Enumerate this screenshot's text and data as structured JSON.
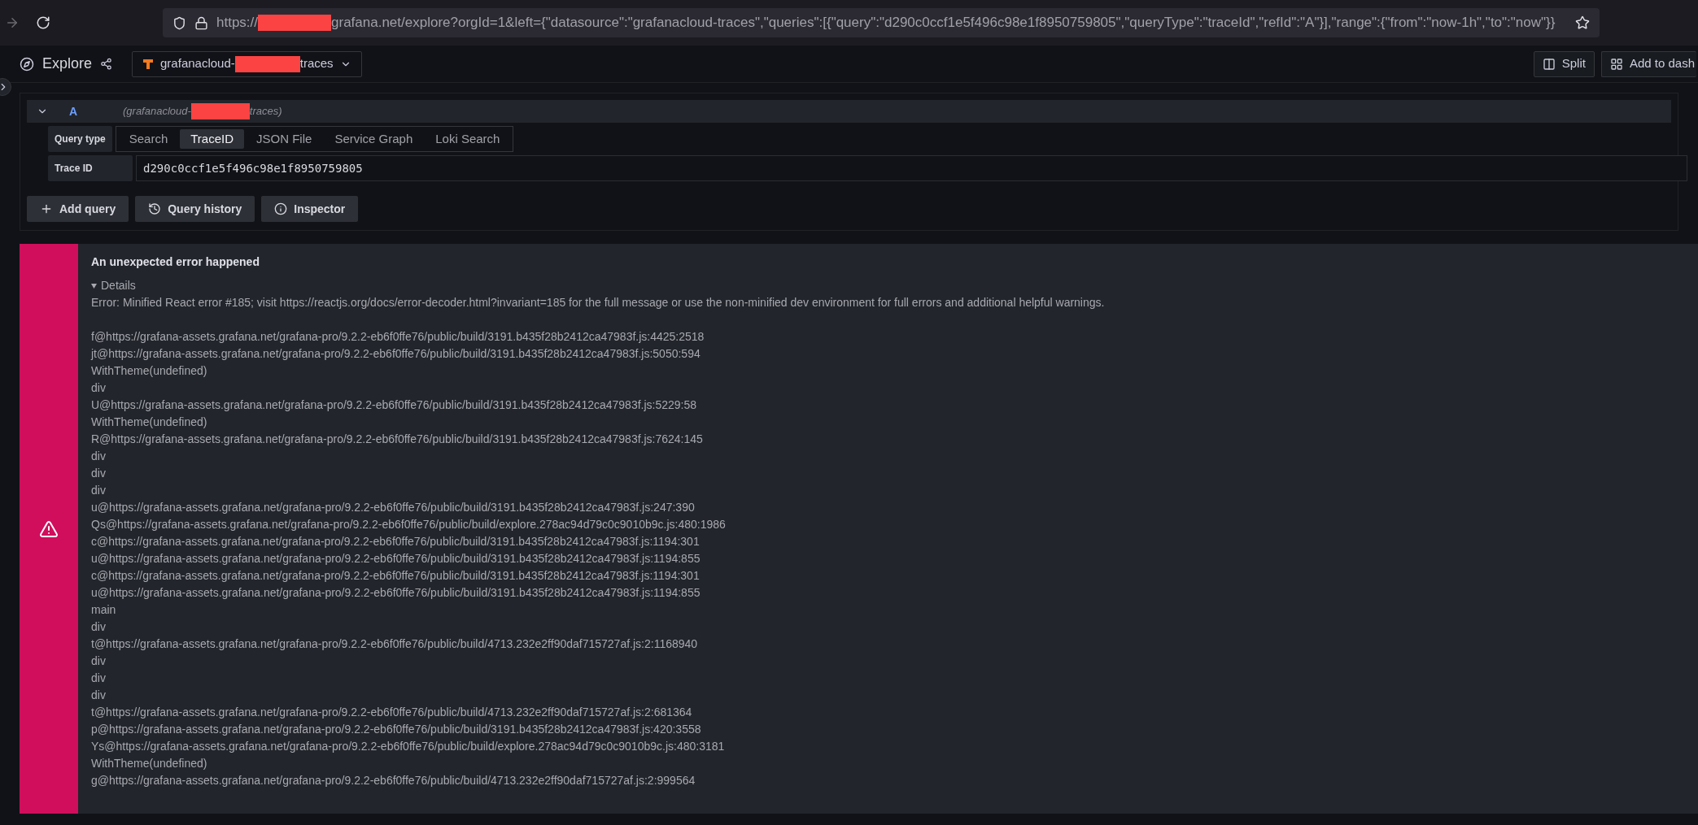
{
  "browser": {
    "url_prefix": "https://",
    "url_rest": "grafana.net/explore?orgId=1&left={\"datasource\":\"grafanacloud-traces\",\"queries\":[{\"query\":\"d290c0ccf1e5f496c98e1f8950759805\",\"queryType\":\"traceId\",\"refId\":\"A\"}],\"range\":{\"from\":\"now-1h\",\"to\":\"now\"}}"
  },
  "header": {
    "title": "Explore",
    "datasource_prefix": "grafanacloud-",
    "datasource_suffix": "traces",
    "buttons": [
      "Split",
      "Add to dash"
    ]
  },
  "query": {
    "ref": "A",
    "source_prefix": "(grafanacloud-",
    "source_suffix": "traces)",
    "type_label": "Query type",
    "types": [
      {
        "label": "Search",
        "selected": false
      },
      {
        "label": "TraceID",
        "selected": true
      },
      {
        "label": "JSON File",
        "selected": false
      },
      {
        "label": "Service Graph",
        "selected": false
      },
      {
        "label": "Loki Search",
        "selected": false
      }
    ],
    "trace_label": "Trace ID",
    "trace_value": "d290c0ccf1e5f496c98e1f8950759805"
  },
  "actions": [
    {
      "kind": "add",
      "label": "Add query"
    },
    {
      "kind": "history",
      "label": "Query history"
    },
    {
      "kind": "inspect",
      "label": "Inspector"
    }
  ],
  "error": {
    "title": "An unexpected error happened",
    "details_label": "Details",
    "message": "Error: Minified React error #185; visit https://reactjs.org/docs/error-decoder.html?invariant=185 for the full message or use the non-minified dev environment for full errors and additional helpful warnings.",
    "stack": [
      "f@https://grafana-assets.grafana.net/grafana-pro/9.2.2-eb6f0ffe76/public/build/3191.b435f28b2412ca47983f.js:4425:2518",
      "jt@https://grafana-assets.grafana.net/grafana-pro/9.2.2-eb6f0ffe76/public/build/3191.b435f28b2412ca47983f.js:5050:594",
      "WithTheme(undefined)",
      "div",
      "U@https://grafana-assets.grafana.net/grafana-pro/9.2.2-eb6f0ffe76/public/build/3191.b435f28b2412ca47983f.js:5229:58",
      "WithTheme(undefined)",
      "R@https://grafana-assets.grafana.net/grafana-pro/9.2.2-eb6f0ffe76/public/build/3191.b435f28b2412ca47983f.js:7624:145",
      "div",
      "div",
      "div",
      "u@https://grafana-assets.grafana.net/grafana-pro/9.2.2-eb6f0ffe76/public/build/3191.b435f28b2412ca47983f.js:247:390",
      "Qs@https://grafana-assets.grafana.net/grafana-pro/9.2.2-eb6f0ffe76/public/build/explore.278ac94d79c0c9010b9c.js:480:1986",
      "c@https://grafana-assets.grafana.net/grafana-pro/9.2.2-eb6f0ffe76/public/build/3191.b435f28b2412ca47983f.js:1194:301",
      "u@https://grafana-assets.grafana.net/grafana-pro/9.2.2-eb6f0ffe76/public/build/3191.b435f28b2412ca47983f.js:1194:855",
      "c@https://grafana-assets.grafana.net/grafana-pro/9.2.2-eb6f0ffe76/public/build/3191.b435f28b2412ca47983f.js:1194:301",
      "u@https://grafana-assets.grafana.net/grafana-pro/9.2.2-eb6f0ffe76/public/build/3191.b435f28b2412ca47983f.js:1194:855",
      "main",
      "div",
      "t@https://grafana-assets.grafana.net/grafana-pro/9.2.2-eb6f0ffe76/public/build/4713.232e2ff90daf715727af.js:2:1168940",
      "div",
      "div",
      "div",
      "t@https://grafana-assets.grafana.net/grafana-pro/9.2.2-eb6f0ffe76/public/build/4713.232e2ff90daf715727af.js:2:681364",
      "p@https://grafana-assets.grafana.net/grafana-pro/9.2.2-eb6f0ffe76/public/build/3191.b435f28b2412ca47983f.js:420:3558",
      "Ys@https://grafana-assets.grafana.net/grafana-pro/9.2.2-eb6f0ffe76/public/build/explore.278ac94d79c0c9010b9c.js:480:3181",
      "WithTheme(undefined)",
      "g@https://grafana-assets.grafana.net/grafana-pro/9.2.2-eb6f0ffe76/public/build/4713.232e2ff90daf715727af.js:2:999564"
    ]
  }
}
